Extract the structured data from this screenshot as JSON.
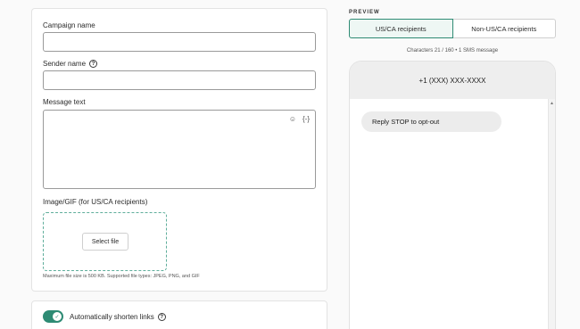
{
  "form": {
    "campaign_name_label": "Campaign name",
    "campaign_name_value": "",
    "sender_name_label": "Sender name",
    "sender_name_value": "",
    "message_text_label": "Message text",
    "emoji_glyph": "☺",
    "variable_glyph": "{-}",
    "image_label": "Image/GIF (for US/CA recipients)",
    "select_file_label": "Select file",
    "file_hint": "Maximum file size is 500 KB. Supported file types: JPEG, PNG, and GIF",
    "help_glyph": "?"
  },
  "links": {
    "shorten_label": "Automatically shorten links",
    "shorten_enabled": true,
    "check_glyph": "✓"
  },
  "preview": {
    "title": "PREVIEW",
    "tabs": [
      "US/CA recipients",
      "Non-US/CA recipients"
    ],
    "active_tab": 0,
    "char_count": "Characters 21 / 160 • 1 SMS message",
    "phone_number": "+1 (XXX) XXX-XXXX",
    "message": "Reply STOP to opt-out",
    "scroll_up_glyph": "▲"
  },
  "colors": {
    "accent": "#2e8b74",
    "border": "#9a9a9a",
    "phone_header": "#eeeeee",
    "bubble": "#ececec"
  }
}
